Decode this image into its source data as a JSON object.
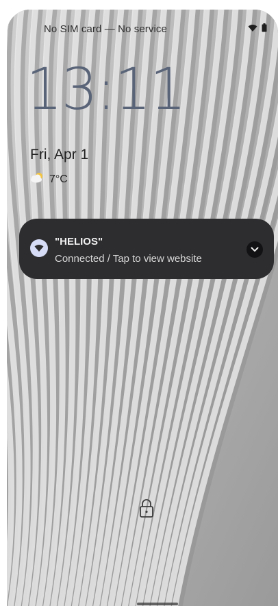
{
  "status_bar": {
    "carrier_text": "No SIM card — No service",
    "icons": [
      "wifi-icon",
      "battery-icon"
    ]
  },
  "lock_screen": {
    "time": "13:11",
    "date": "Fri, Apr 1",
    "weather": {
      "icon": "partly-cloudy-icon",
      "temperature": "7°C"
    }
  },
  "notification": {
    "icon": "wifi-icon",
    "title": "\"HELIOS\"",
    "text": "Connected / Tap to view website",
    "expand_icon": "chevron-down-icon"
  },
  "bottom": {
    "lock_icon": "lock-icon"
  },
  "colors": {
    "clock": "#5a6478",
    "notification_bg": "#2d2d30",
    "notification_icon_bg": "#d6dcf5",
    "wallpaper": "#a9a9a9"
  }
}
